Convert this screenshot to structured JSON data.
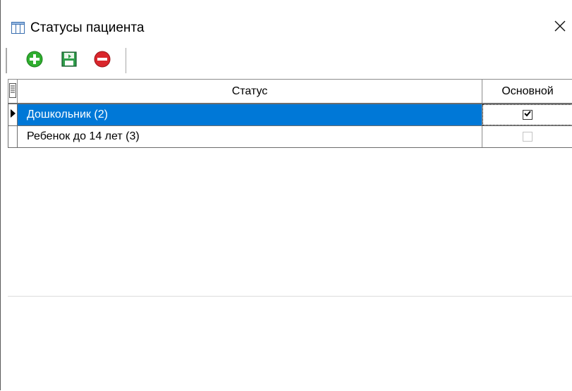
{
  "window": {
    "title": "Статусы пациента",
    "close_symbol": "✕"
  },
  "toolbar": {
    "buttons": [
      {
        "name": "add",
        "icon": "plus-circle-green-icon",
        "color": "#2fae2f"
      },
      {
        "name": "save",
        "icon": "save-floppy-green-icon",
        "color": "#1e7a3c"
      },
      {
        "name": "delete",
        "icon": "minus-circle-red-icon",
        "color": "#d9262c"
      }
    ]
  },
  "grid": {
    "columns": [
      "Статус",
      "Основной"
    ],
    "rows": [
      {
        "status": "Дошкольник (2)",
        "main": true,
        "selected": true
      },
      {
        "status": "Ребенок до 14 лет (3)",
        "main": false,
        "selected": false
      }
    ],
    "selection_color": "#0078d7"
  }
}
